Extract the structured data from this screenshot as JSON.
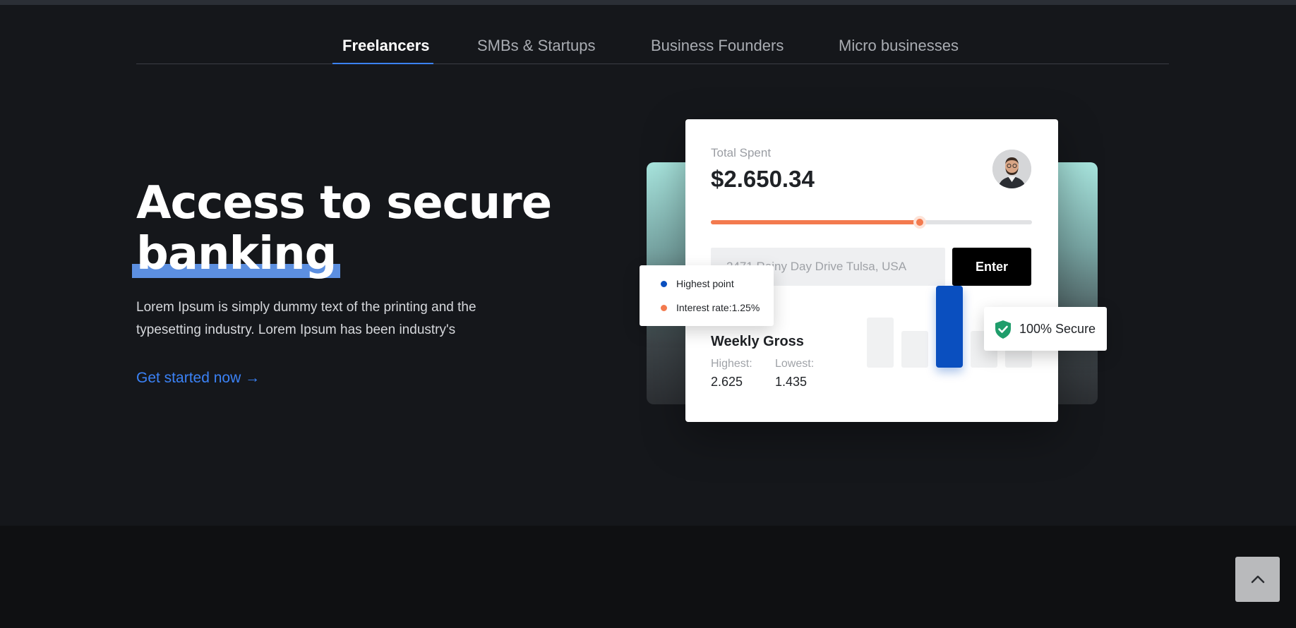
{
  "nav": {
    "tabs": [
      {
        "label": "Freelancers",
        "active": true
      },
      {
        "label": "SMBs & Startups",
        "active": false
      },
      {
        "label": "Business Founders",
        "active": false
      },
      {
        "label": "Micro businesses",
        "active": false
      }
    ]
  },
  "hero": {
    "title_line1": "Access to secure",
    "title_highlight": "banking",
    "description": "Lorem Ipsum is simply dummy text of the printing and the typesetting industry. Lorem Ipsum has been industry's",
    "cta_label": "Get started now →"
  },
  "card": {
    "total_label": "Total Spent",
    "total_amount": "$2.650.34",
    "avatar_icon": "user-avatar-icon",
    "slider_percent": 65,
    "address_placeholder": "2471 Rainy Day Drive Tulsa, USA",
    "enter_label": "Enter",
    "weekly": {
      "title": "Weekly Gross",
      "highest_label": "Highest:",
      "highest_value": "2.625",
      "lowest_label": "Lowest:",
      "lowest_value": "1.435"
    },
    "bars": [
      {
        "level": 0.61,
        "highlight": false
      },
      {
        "level": 0.45,
        "highlight": false
      },
      {
        "level": 1.0,
        "highlight": true
      },
      {
        "level": 0.45,
        "highlight": false
      },
      {
        "level": 0.45,
        "highlight": false
      }
    ]
  },
  "legend": {
    "items": [
      {
        "label": "Highest point",
        "color": "#0a4fbf"
      },
      {
        "label": "Interest rate:1.25%",
        "color": "#f37a4e"
      }
    ]
  },
  "secure_badge": {
    "label": "100% Secure",
    "icon": "shield-check-icon",
    "color": "#1f9d6b"
  },
  "scroll_top": {
    "icon": "chevron-up-icon"
  },
  "colors": {
    "accent": "#3b82f6",
    "orange": "#f37a4e",
    "dark_bg": "#15171b"
  }
}
